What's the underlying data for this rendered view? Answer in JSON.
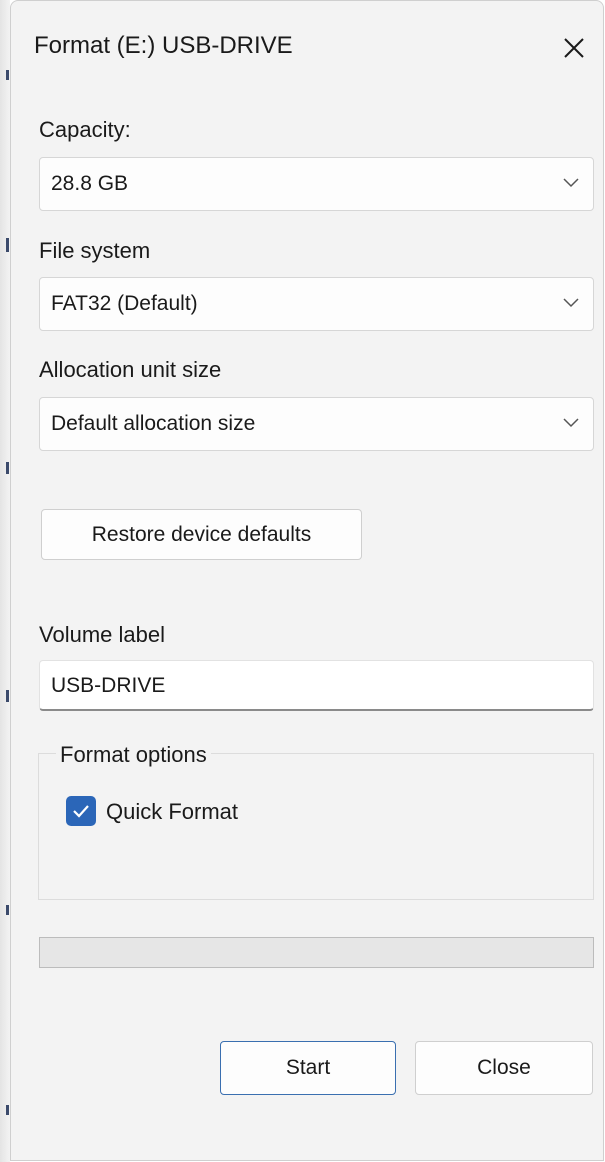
{
  "window": {
    "title": "Format (E:) USB-DRIVE",
    "close_icon": "close-icon"
  },
  "capacity": {
    "label": "Capacity:",
    "value": "28.8 GB"
  },
  "file_system": {
    "label": "File system",
    "value": "FAT32 (Default)"
  },
  "allocation": {
    "label": "Allocation unit size",
    "value": "Default allocation size"
  },
  "restore_button": {
    "label": "Restore device defaults"
  },
  "volume": {
    "label": "Volume label",
    "value": "USB-DRIVE"
  },
  "format_options": {
    "legend": "Format options",
    "quick_format_label": "Quick Format",
    "quick_format_checked": true
  },
  "progress": {
    "fraction": 0
  },
  "buttons": {
    "start": "Start",
    "close": "Close"
  },
  "colors": {
    "accent": "#2b66b8",
    "dialog_bg": "#f3f3f3",
    "primary_border": "#3a6fb0"
  }
}
